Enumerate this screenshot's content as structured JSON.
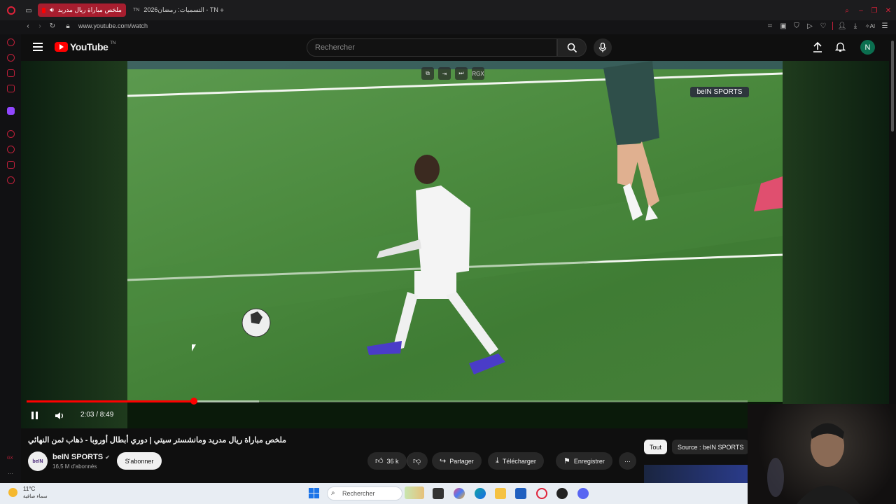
{
  "browser": {
    "tabs": [
      {
        "label": "ملخص مباراة ريال مدريد",
        "active": true
      },
      {
        "label": "التسميات: رمضان2026 - TN",
        "active": false
      }
    ],
    "url": "www.youtube.com/watch"
  },
  "youtube": {
    "logo_text": "YouTube",
    "logo_region": "TN",
    "search_placeholder": "Rechercher",
    "avatar_letter": "N"
  },
  "player": {
    "time_display": "2:03 / 8:49",
    "progress_fraction": 0.2325,
    "buffered_fraction": 0.322,
    "overlay_brand": "beIN SPORTS",
    "pip_label": "RGX"
  },
  "video_info": {
    "title": "ملخص مباراة ريال مدريد ومانشستر سيتي | دوري أبطال أوروبا - ذهاب ثمن النهائي",
    "channel_name": "beIN SPORTS",
    "subscribers": "16,5 M d'abonnés",
    "subscribe_label": "S'abonner",
    "likes": "36 k",
    "share_label": "Partager",
    "download_label": "Télécharger",
    "save_label": "Enregistrer"
  },
  "chips": {
    "all": "Tout",
    "source": "Source : beIN SPORTS"
  },
  "taskbar": {
    "temperature": "11°C",
    "weather": "سماء صافية",
    "search_placeholder": "Rechercher"
  },
  "colors": {
    "accent_red": "#ff0000",
    "tab_active": "#a81e2f",
    "background": "#0f0f0f"
  }
}
